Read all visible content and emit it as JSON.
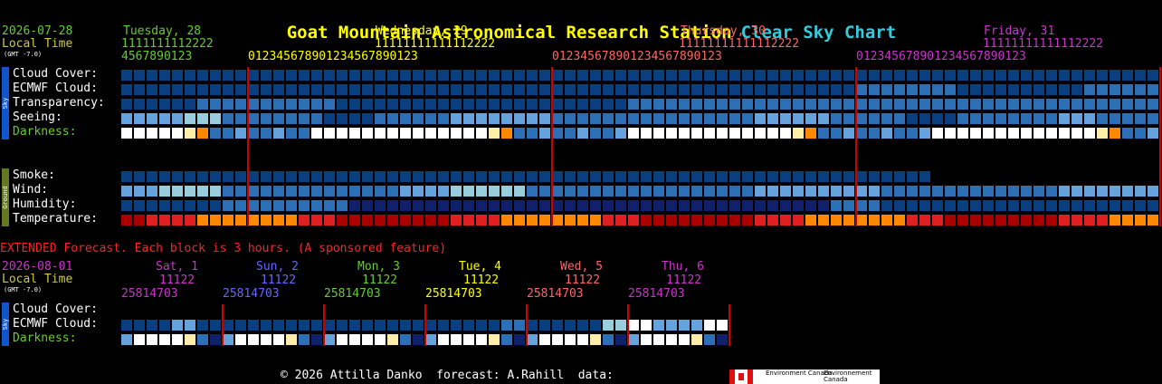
{
  "title": "Goat Mountain Astronomical Research Station",
  "subtitle": "Clear Sky Chart",
  "top_section": {
    "date": "2026-07-28",
    "local_time_label": "Local Time",
    "gmt_label": "(GMT -7.0)",
    "days": [
      {
        "label": "Tuesday, 28",
        "color": "#66cc33"
      },
      {
        "label": "Wednesday, 29",
        "color": "#ffff00"
      },
      {
        "label": "Thursday, 30",
        "color": "#ff6666"
      },
      {
        "label": "Friday, 31",
        "color": "#cc33cc"
      }
    ],
    "hour_tens_rows": [
      "1111111112222",
      "11111111111112222",
      "11111111111112222",
      "11111111111112222"
    ],
    "hour_units_rows": [
      "4567890123",
      "012345678901234567890123",
      "012345678901234567890123",
      "012345678901234567890123"
    ],
    "sky_label": "Sky",
    "ground_label": "Ground",
    "rows": [
      {
        "label": "Cloud Cover:",
        "color": "#ffffff"
      },
      {
        "label": "ECMWF Cloud:",
        "color": "#ffffff"
      },
      {
        "label": "Transparency:",
        "color": "#ffffff"
      },
      {
        "label": "Seeing:",
        "color": "#ffffff"
      },
      {
        "label": "Darkness:",
        "color": "#66cc33"
      },
      {
        "label": "Smoke:",
        "color": "#ffffff"
      },
      {
        "label": "Wind:",
        "color": "#ffffff"
      },
      {
        "label": "Humidity:",
        "color": "#ffffff"
      },
      {
        "label": "Temperature:",
        "color": "#ffffff"
      }
    ]
  },
  "extended": {
    "notice": "EXTENDED Forecast. Each block is 3 hours. (A sponsored feature)",
    "date": "2026-08-01",
    "local_time_label": "Local Time",
    "gmt_label": "(GMT -7.0)",
    "days": [
      {
        "label": "Sat, 1",
        "color": "#cc33cc"
      },
      {
        "label": "Sun, 2",
        "color": "#6666ff"
      },
      {
        "label": "Mon, 3",
        "color": "#66cc33"
      },
      {
        "label": "Tue, 4",
        "color": "#ffff00"
      },
      {
        "label": "Wed, 5",
        "color": "#ff6666"
      },
      {
        "label": "Thu, 6",
        "color": "#cc33cc"
      }
    ],
    "tens_pattern": "11122",
    "units_pattern": "25814703",
    "rows": [
      {
        "label": "Cloud Cover:",
        "color": "#ffffff"
      },
      {
        "label": "ECMWF Cloud:",
        "color": "#ffffff"
      },
      {
        "label": "Darkness:",
        "color": "#66cc33"
      }
    ]
  },
  "footer": {
    "text": "© 2026 Attilla Danko  forecast: A.Rahill  data:",
    "logo_left": "Environment Canada",
    "logo_right": "Environnement Canada"
  },
  "colors": {
    "dark_blue": "#0a3f7f",
    "mid_blue": "#2d6fb5",
    "light_blue": "#66a3dd",
    "teal": "#99ccdd",
    "white": "#ffffff",
    "cream": "#ffeeaa",
    "orange": "#ff8800",
    "red": "#e02020",
    "deep_red": "#aa0000",
    "divider": "#cc0000"
  }
}
